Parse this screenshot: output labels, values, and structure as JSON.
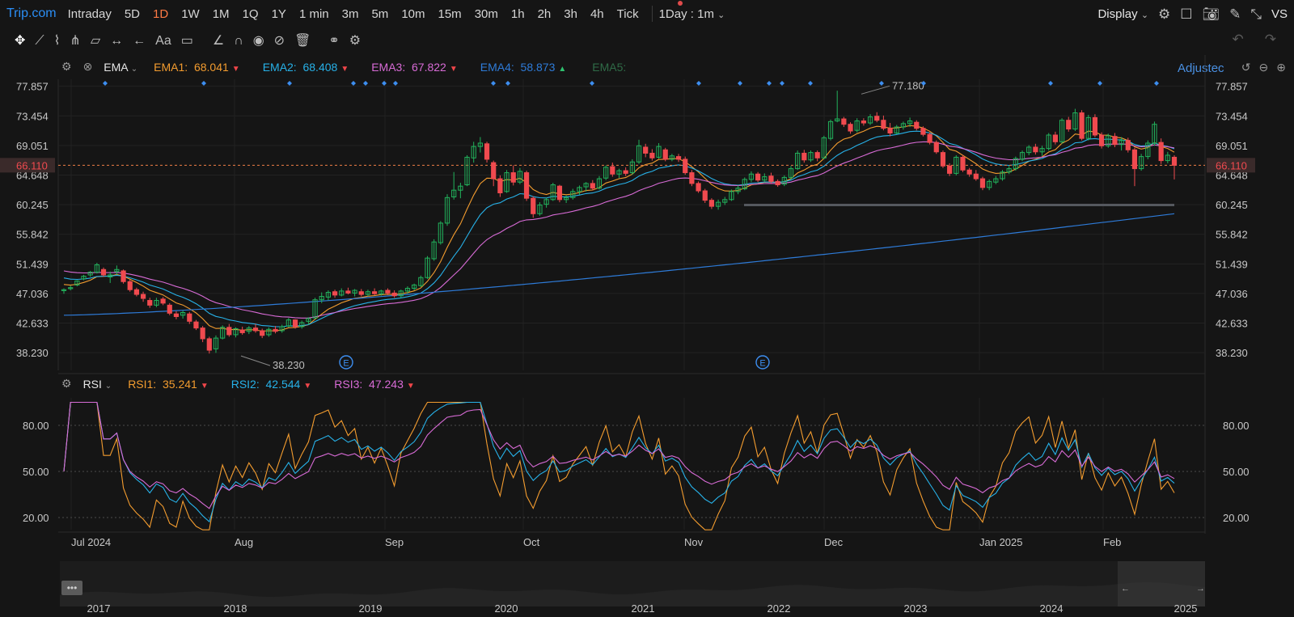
{
  "topbar": {
    "brand": "Trip.com",
    "intervals": [
      "Intraday",
      "5D",
      "1D",
      "1W",
      "1M",
      "1Q",
      "1Y",
      "1 min",
      "3m",
      "5m",
      "10m",
      "15m",
      "30m",
      "1h",
      "2h",
      "3h",
      "4h",
      "Tick"
    ],
    "active_interval": "1D",
    "range_select": "1Day : 1m",
    "display_label": "Display",
    "vs_label": "VS"
  },
  "main_indicator": {
    "name": "EMA",
    "ema1": {
      "label": "EMA1:",
      "value": "68.041",
      "color": "#f39c2f"
    },
    "ema2": {
      "label": "EMA2:",
      "value": "68.408",
      "color": "#27b1e8"
    },
    "ema3": {
      "label": "EMA3:",
      "value": "67.822",
      "color": "#d86bd6"
    },
    "ema4": {
      "label": "EMA4:",
      "value": "58.873",
      "color": "#2e7bd8"
    },
    "ema5": {
      "label": "EMA5:",
      "value": "",
      "color": "#2f6b47"
    },
    "adjusted_label": "Adjustec"
  },
  "sub_indicator": {
    "name": "RSI",
    "rsi1": {
      "label": "RSI1:",
      "value": "35.241",
      "color": "#f39c2f"
    },
    "rsi2": {
      "label": "RSI2:",
      "value": "42.544",
      "color": "#27b1e8"
    },
    "rsi3": {
      "label": "RSI3:",
      "value": "47.243",
      "color": "#d86bd6"
    }
  },
  "chart_data": {
    "type": "candlestick",
    "price_axis_ticks": [
      "77.857",
      "73.454",
      "69.051",
      "64.648",
      "60.245",
      "55.842",
      "51.439",
      "47.036",
      "42.633",
      "38.230"
    ],
    "last_price": "66.110",
    "high_marker": "77.180",
    "low_marker": "38.230",
    "support_line": 60.2,
    "rsi_axis_ticks": [
      "80.00",
      "50.00",
      "20.00"
    ],
    "time_axis": [
      "Jul 2024",
      "Aug",
      "Sep",
      "Oct",
      "Nov",
      "Dec",
      "Jan 2025",
      "Feb"
    ],
    "navigator_years": [
      "2017",
      "2018",
      "2019",
      "2020",
      "2021",
      "2022",
      "2023",
      "2024",
      "2025"
    ],
    "earnings_markers": [
      "E",
      "E"
    ],
    "candles": [
      [
        47.5,
        47.8,
        47.0,
        47.6
      ],
      [
        47.8,
        48.2,
        47.5,
        47.9
      ],
      [
        48.3,
        49.0,
        48.1,
        48.9
      ],
      [
        49.2,
        49.8,
        49.0,
        49.6
      ],
      [
        49.8,
        50.4,
        49.5,
        50.2
      ],
      [
        50.2,
        51.6,
        50.0,
        51.3
      ],
      [
        50.6,
        50.9,
        49.5,
        49.8
      ],
      [
        49.5,
        50.3,
        48.6,
        49.8
      ],
      [
        50.3,
        51.2,
        49.8,
        50.6
      ],
      [
        50.4,
        50.6,
        48.5,
        48.8
      ],
      [
        48.8,
        49.1,
        47.3,
        47.6
      ],
      [
        47.6,
        47.9,
        46.6,
        46.9
      ],
      [
        46.9,
        47.3,
        45.8,
        46.3
      ],
      [
        46.0,
        46.4,
        44.9,
        45.3
      ],
      [
        45.3,
        46.4,
        45.0,
        46.0
      ],
      [
        46.2,
        46.5,
        45.3,
        45.6
      ],
      [
        45.3,
        45.6,
        43.8,
        44.1
      ],
      [
        44.0,
        44.4,
        43.2,
        43.6
      ],
      [
        43.8,
        44.5,
        43.3,
        44.2
      ],
      [
        44.0,
        44.3,
        42.5,
        42.9
      ],
      [
        42.8,
        43.1,
        41.6,
        41.9
      ],
      [
        41.9,
        42.2,
        39.8,
        40.3
      ],
      [
        40.3,
        40.6,
        38.1,
        38.6
      ],
      [
        38.8,
        40.8,
        38.2,
        40.4
      ],
      [
        40.4,
        42.3,
        40.2,
        42.0
      ],
      [
        42.0,
        42.5,
        40.6,
        40.9
      ],
      [
        40.9,
        42.0,
        40.5,
        41.8
      ],
      [
        41.6,
        42.1,
        40.9,
        41.2
      ],
      [
        41.4,
        42.2,
        41.0,
        41.9
      ],
      [
        41.9,
        42.5,
        41.2,
        41.5
      ],
      [
        41.5,
        41.8,
        40.4,
        40.8
      ],
      [
        40.9,
        42.0,
        40.6,
        41.7
      ],
      [
        41.7,
        42.2,
        41.1,
        41.4
      ],
      [
        41.5,
        42.4,
        41.2,
        42.1
      ],
      [
        42.2,
        43.4,
        42.0,
        43.1
      ],
      [
        43.1,
        43.2,
        41.8,
        42.1
      ],
      [
        42.1,
        43.0,
        41.8,
        42.7
      ],
      [
        42.9,
        43.5,
        42.4,
        43.3
      ],
      [
        43.4,
        46.4,
        43.2,
        46.1
      ],
      [
        46.1,
        47.2,
        45.6,
        46.6
      ],
      [
        46.5,
        47.5,
        46.0,
        47.2
      ],
      [
        47.3,
        47.6,
        46.4,
        46.8
      ],
      [
        46.8,
        47.8,
        46.6,
        47.4
      ],
      [
        47.4,
        47.9,
        46.9,
        47.1
      ],
      [
        47.1,
        47.7,
        46.6,
        47.5
      ],
      [
        47.3,
        47.7,
        46.6,
        46.9
      ],
      [
        46.9,
        47.6,
        46.6,
        47.3
      ],
      [
        47.3,
        47.8,
        46.8,
        47.0
      ],
      [
        47.0,
        47.6,
        46.7,
        47.4
      ],
      [
        47.5,
        47.8,
        46.8,
        47.1
      ],
      [
        47.1,
        47.5,
        46.4,
        46.7
      ],
      [
        46.7,
        47.6,
        46.4,
        47.4
      ],
      [
        47.4,
        48.1,
        47.0,
        47.8
      ],
      [
        47.8,
        48.5,
        47.5,
        48.3
      ],
      [
        48.2,
        49.7,
        48.0,
        49.4
      ],
      [
        49.4,
        52.6,
        49.2,
        52.3
      ],
      [
        52.2,
        55.1,
        51.9,
        54.7
      ],
      [
        54.6,
        57.8,
        54.3,
        57.5
      ],
      [
        57.5,
        61.8,
        57.1,
        61.3
      ],
      [
        61.4,
        65.1,
        61.0,
        62.4
      ],
      [
        62.4,
        63.5,
        61.2,
        63.0
      ],
      [
        63.2,
        67.6,
        63.0,
        67.3
      ],
      [
        67.2,
        69.6,
        66.5,
        68.9
      ],
      [
        68.9,
        70.3,
        68.0,
        69.4
      ],
      [
        69.3,
        69.6,
        66.5,
        67.0
      ],
      [
        66.5,
        66.8,
        63.0,
        64.1
      ],
      [
        64.1,
        64.6,
        61.4,
        62.0
      ],
      [
        62.2,
        65.4,
        62.0,
        65.0
      ],
      [
        65.0,
        66.1,
        63.1,
        63.6
      ],
      [
        63.6,
        65.7,
        63.3,
        65.2
      ],
      [
        65.0,
        65.3,
        60.8,
        61.2
      ],
      [
        61.2,
        61.5,
        58.3,
        58.9
      ],
      [
        58.9,
        60.6,
        58.6,
        60.2
      ],
      [
        60.3,
        61.3,
        59.8,
        61.0
      ],
      [
        61.0,
        63.5,
        60.8,
        63.2
      ],
      [
        63.0,
        63.2,
        60.6,
        61.0
      ],
      [
        61.0,
        61.6,
        60.5,
        61.3
      ],
      [
        61.3,
        62.6,
        61.0,
        62.2
      ],
      [
        62.2,
        63.1,
        61.7,
        62.8
      ],
      [
        62.9,
        63.6,
        62.2,
        63.4
      ],
      [
        63.4,
        63.9,
        62.4,
        62.7
      ],
      [
        62.7,
        64.5,
        62.5,
        64.1
      ],
      [
        64.2,
        66.1,
        63.9,
        65.8
      ],
      [
        65.9,
        66.5,
        64.4,
        64.8
      ],
      [
        64.8,
        65.6,
        64.2,
        65.3
      ],
      [
        65.3,
        65.8,
        64.5,
        64.9
      ],
      [
        65.0,
        67.0,
        64.7,
        66.6
      ],
      [
        66.6,
        69.9,
        66.3,
        69.0
      ],
      [
        68.8,
        69.3,
        67.3,
        67.9
      ],
      [
        67.9,
        68.5,
        66.8,
        67.2
      ],
      [
        67.3,
        69.4,
        67.1,
        68.9
      ],
      [
        68.4,
        68.7,
        66.7,
        67.0
      ],
      [
        67.0,
        67.8,
        66.7,
        67.5
      ],
      [
        67.4,
        67.8,
        66.6,
        67.0
      ],
      [
        67.0,
        67.4,
        64.7,
        65.0
      ],
      [
        65.0,
        65.4,
        63.0,
        63.4
      ],
      [
        63.4,
        63.7,
        62.0,
        62.3
      ],
      [
        62.3,
        62.6,
        60.5,
        60.9
      ],
      [
        60.9,
        61.2,
        59.6,
        60.0
      ],
      [
        60.0,
        61.0,
        59.5,
        60.6
      ],
      [
        60.6,
        61.4,
        60.2,
        61.0
      ],
      [
        61.0,
        62.5,
        60.8,
        62.2
      ],
      [
        62.2,
        63.1,
        61.8,
        62.7
      ],
      [
        62.6,
        64.3,
        62.4,
        64.0
      ],
      [
        64.0,
        65.2,
        63.6,
        64.8
      ],
      [
        64.8,
        65.1,
        63.6,
        63.9
      ],
      [
        63.9,
        64.9,
        63.6,
        64.4
      ],
      [
        64.5,
        65.0,
        63.4,
        63.7
      ],
      [
        63.7,
        64.0,
        62.9,
        63.2
      ],
      [
        63.3,
        64.6,
        63.0,
        64.3
      ],
      [
        64.3,
        66.0,
        64.0,
        65.6
      ],
      [
        65.6,
        68.3,
        65.4,
        67.9
      ],
      [
        67.9,
        68.4,
        66.5,
        66.9
      ],
      [
        66.9,
        68.3,
        66.6,
        68.0
      ],
      [
        68.0,
        68.3,
        66.7,
        67.2
      ],
      [
        67.2,
        70.5,
        67.0,
        70.2
      ],
      [
        70.1,
        72.9,
        69.8,
        72.6
      ],
      [
        72.7,
        77.2,
        72.5,
        73.0
      ],
      [
        73.0,
        73.3,
        71.8,
        72.2
      ],
      [
        72.2,
        72.5,
        70.8,
        71.2
      ],
      [
        71.3,
        73.1,
        71.0,
        72.7
      ],
      [
        72.7,
        73.1,
        72.0,
        72.4
      ],
      [
        72.4,
        73.7,
        72.1,
        73.3
      ],
      [
        73.4,
        74.0,
        72.5,
        72.8
      ],
      [
        72.8,
        73.5,
        71.3,
        71.6
      ],
      [
        71.6,
        72.4,
        70.4,
        70.9
      ],
      [
        70.9,
        72.1,
        70.7,
        71.8
      ],
      [
        71.8,
        72.6,
        71.4,
        72.3
      ],
      [
        72.3,
        73.2,
        71.8,
        72.7
      ],
      [
        72.5,
        72.8,
        71.3,
        71.6
      ],
      [
        71.6,
        71.9,
        70.4,
        70.7
      ],
      [
        70.7,
        71.0,
        69.2,
        69.5
      ],
      [
        69.5,
        69.8,
        67.8,
        68.1
      ],
      [
        68.0,
        68.3,
        65.7,
        66.0
      ],
      [
        66.0,
        66.4,
        64.5,
        64.9
      ],
      [
        64.9,
        67.6,
        64.6,
        67.3
      ],
      [
        67.3,
        67.6,
        65.1,
        65.4
      ],
      [
        65.4,
        65.7,
        64.4,
        64.8
      ],
      [
        64.8,
        65.4,
        63.8,
        64.1
      ],
      [
        64.1,
        64.4,
        62.4,
        62.8
      ],
      [
        62.8,
        64.0,
        62.4,
        63.7
      ],
      [
        63.6,
        64.5,
        63.3,
        64.1
      ],
      [
        64.1,
        65.4,
        63.8,
        65.1
      ],
      [
        65.1,
        66.0,
        64.8,
        65.6
      ],
      [
        65.6,
        67.4,
        65.3,
        67.1
      ],
      [
        67.0,
        68.3,
        66.7,
        68.0
      ],
      [
        68.0,
        69.1,
        67.6,
        68.8
      ],
      [
        68.8,
        69.3,
        67.7,
        68.1
      ],
      [
        68.1,
        69.0,
        67.5,
        68.6
      ],
      [
        68.6,
        70.9,
        68.3,
        70.6
      ],
      [
        70.6,
        71.1,
        69.2,
        69.6
      ],
      [
        69.6,
        73.1,
        69.3,
        72.8
      ],
      [
        72.8,
        73.3,
        71.1,
        71.5
      ],
      [
        71.5,
        74.5,
        71.2,
        73.9
      ],
      [
        73.9,
        74.3,
        69.8,
        70.1
      ],
      [
        70.1,
        73.6,
        69.8,
        73.2
      ],
      [
        73.2,
        73.7,
        70.3,
        70.6
      ],
      [
        70.6,
        71.0,
        68.6,
        69.0
      ],
      [
        69.0,
        70.8,
        68.7,
        70.5
      ],
      [
        70.4,
        70.9,
        68.8,
        69.2
      ],
      [
        69.2,
        70.3,
        68.3,
        69.8
      ],
      [
        69.8,
        70.2,
        68.0,
        68.4
      ],
      [
        68.4,
        68.7,
        63.0,
        65.6
      ],
      [
        65.6,
        67.8,
        65.3,
        67.4
      ],
      [
        67.4,
        69.8,
        67.0,
        69.4
      ],
      [
        69.4,
        72.6,
        69.0,
        72.2
      ],
      [
        69.5,
        70.1,
        66.3,
        66.8
      ],
      [
        66.8,
        68.1,
        66.4,
        67.6
      ],
      [
        67.3,
        67.6,
        64.0,
        66.1
      ]
    ]
  }
}
